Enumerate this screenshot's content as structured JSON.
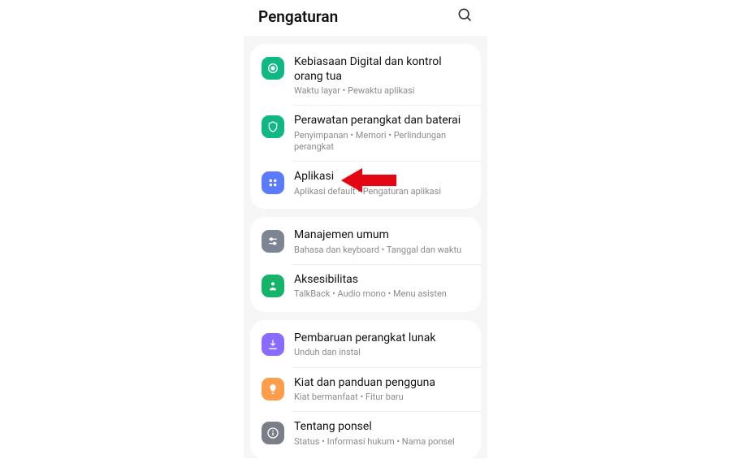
{
  "header": {
    "title": "Pengaturan"
  },
  "colors": {
    "teal1": "#0fb883",
    "teal2": "#0fb883",
    "blue": "#5b7bff",
    "gray": "#7c8591",
    "green": "#16b36a",
    "purple": "#8a6bff",
    "orange": "#ff9d4a",
    "darkgray": "#7a7e86"
  },
  "g1": [
    {
      "title": "Kebiasaan Digital dan kontrol orang tua",
      "sub": "Waktu layar  •  Pewaktu aplikasi",
      "icon": "target",
      "color": "teal1"
    },
    {
      "title": "Perawatan perangkat dan baterai",
      "sub": "Penyimpanan  •  Memori  •  Perlindungan perangkat",
      "icon": "care",
      "color": "teal2"
    },
    {
      "title": "Aplikasi",
      "sub": "Aplikasi default  •  Pengaturan aplikasi",
      "icon": "apps",
      "color": "blue"
    }
  ],
  "g2": [
    {
      "title": "Manajemen umum",
      "sub": "Bahasa dan keyboard  •  Tanggal dan waktu",
      "icon": "sliders",
      "color": "gray"
    },
    {
      "title": "Aksesibilitas",
      "sub": "TalkBack  •  Audio mono  •  Menu asisten",
      "icon": "person",
      "color": "green"
    }
  ],
  "g3": [
    {
      "title": "Pembaruan perangkat lunak",
      "sub": "Unduh dan instal",
      "icon": "download",
      "color": "purple"
    },
    {
      "title": "Kiat dan panduan pengguna",
      "sub": "Kiat bermanfaat  •  Fitur baru",
      "icon": "bulb",
      "color": "orange"
    },
    {
      "title": "Tentang ponsel",
      "sub": "Status  •  Informasi hukum  •  Nama ponsel",
      "icon": "info",
      "color": "darkgray"
    }
  ]
}
